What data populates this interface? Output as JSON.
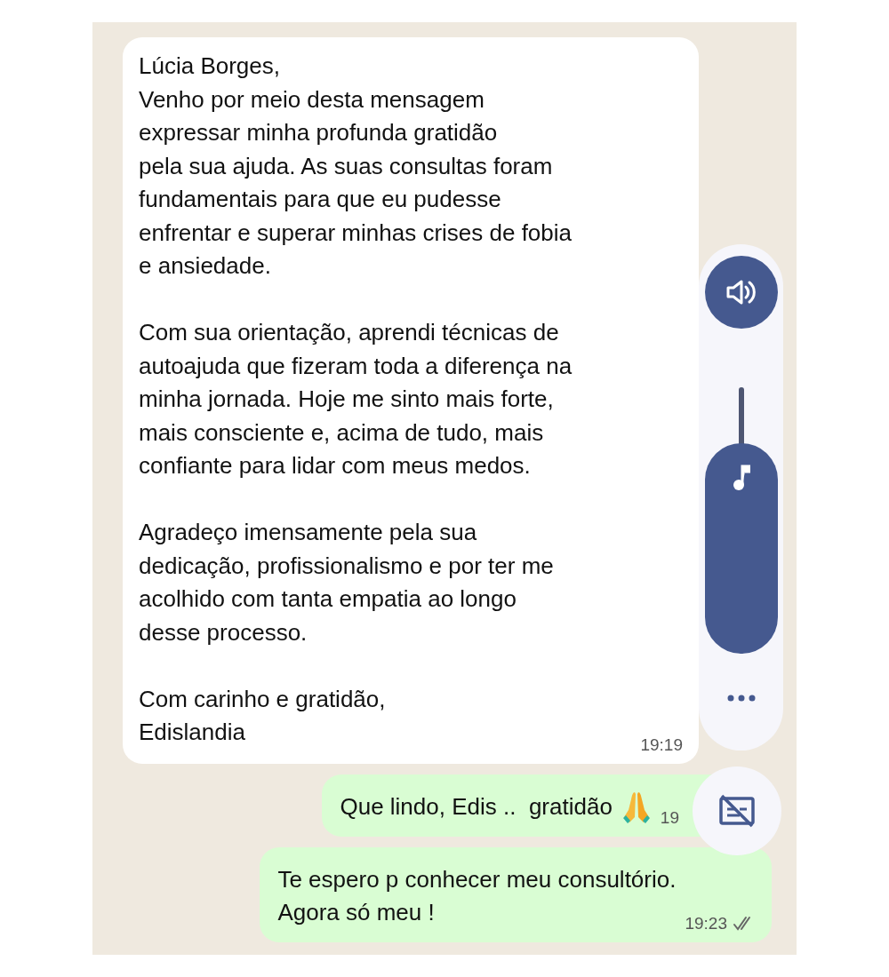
{
  "messages": [
    {
      "kind": "received",
      "text": "Lúcia Borges,\nVenho por meio desta mensagem\nexpressar minha profunda gratidão\npela sua ajuda. As suas consultas foram\nfundamentais para que eu pudesse\nenfrentar e superar minhas crises de fobia\ne ansiedade.\n\nCom sua orientação, aprendi técnicas de\nautoajuda que fizeram toda a diferença na\nminha jornada. Hoje me sinto mais forte,\nmais consciente e, acima de tudo, mais\nconfiante para lidar com meus medos.\n\nAgradeço imensamente pela sua\ndedicação, profissionalismo e por ter me\nacolhido com tanta empatia ao longo\ndesse processo.\n\nCom carinho e gratidão,\nEdislandia",
      "time": "19:19"
    },
    {
      "kind": "sent_emoji",
      "text": "Que lindo, Edis ..  gratidão",
      "time": "19"
    },
    {
      "kind": "sent",
      "text": "Te espero p conhecer meu consultório.\nAgora só meu !",
      "time": "19:23",
      "read": false
    }
  ],
  "volume_panel": {
    "level": 0.79
  }
}
